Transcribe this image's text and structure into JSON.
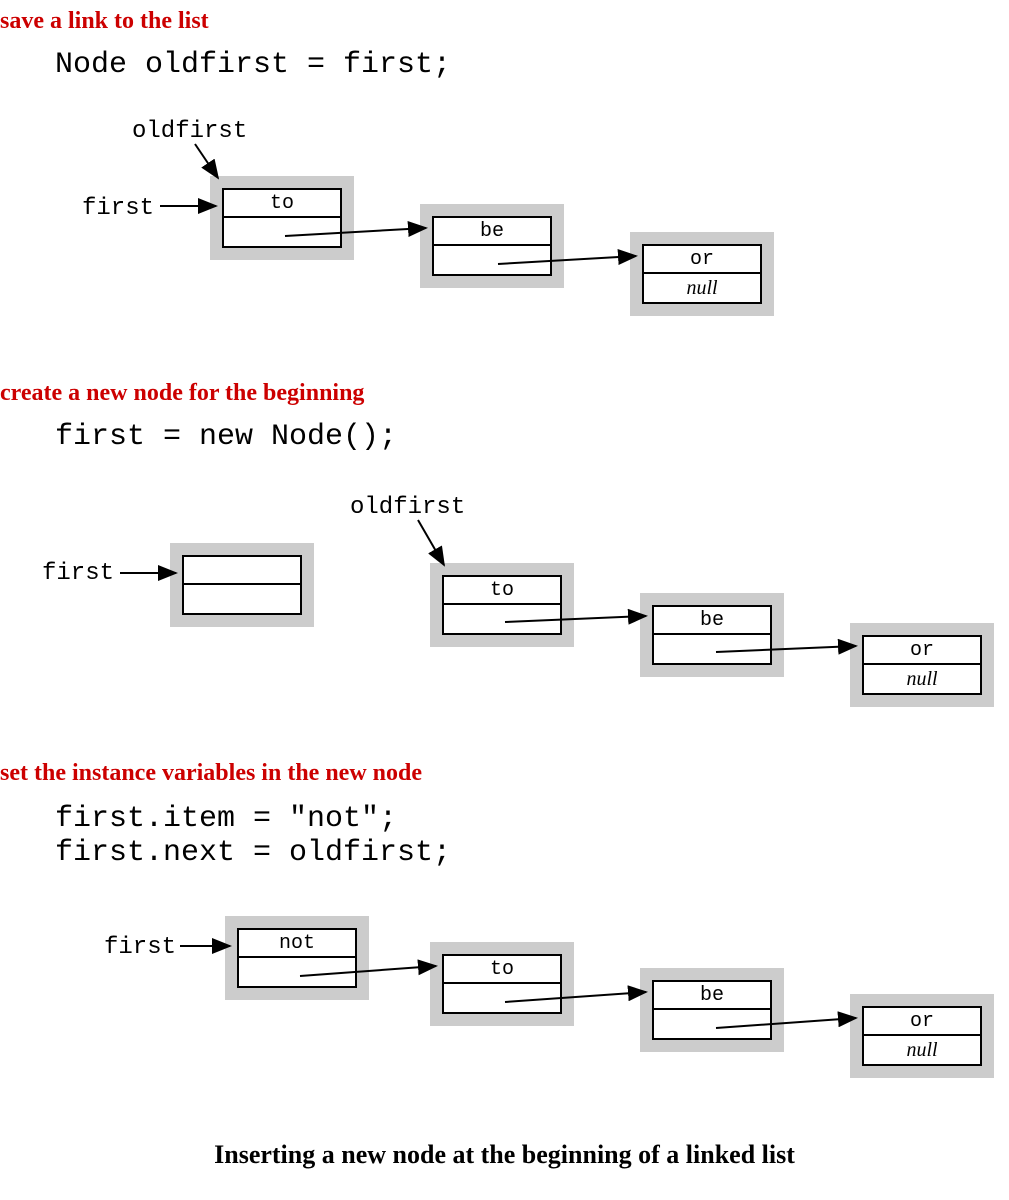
{
  "steps": [
    {
      "heading": "save a link to the list",
      "code": "Node oldfirst = first;"
    },
    {
      "heading": "create a new node for the beginning",
      "code": "first = new Node();"
    },
    {
      "heading": "set the instance variables in the new node",
      "code": "first.item = \"not\";\nfirst.next = oldfirst;"
    }
  ],
  "labels": {
    "first": "first",
    "oldfirst": "oldfirst"
  },
  "node_items": {
    "to": "to",
    "be": "be",
    "or": "or",
    "not": "not",
    "null": "null",
    "empty": ""
  },
  "caption": "Inserting a new node at the beginning of a linked list"
}
